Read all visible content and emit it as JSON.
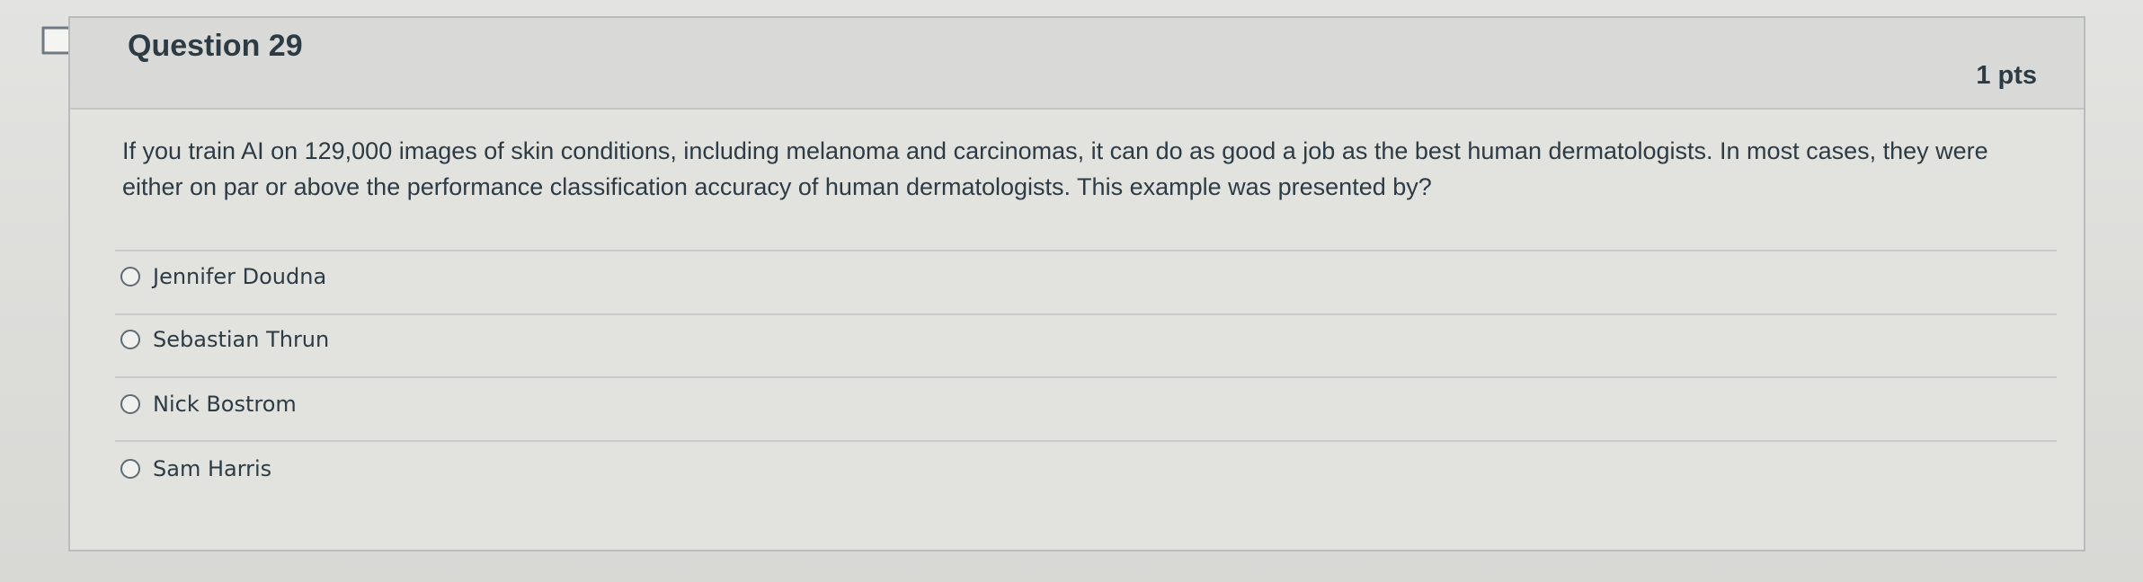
{
  "question": {
    "title": "Question 29",
    "points": "1 pts",
    "text": "If you train AI on 129,000 images of skin conditions, including melanoma and carcinomas, it can do as good a job as the best human dermatologists. In most cases, they were either on par or above the performance classification accuracy of human dermatologists. This example was presented by?"
  },
  "answers": [
    {
      "label": "Jennifer Doudna"
    },
    {
      "label": "Sebastian Thrun"
    },
    {
      "label": "Nick Bostrom"
    },
    {
      "label": "Sam Harris"
    }
  ],
  "icons": {
    "flag": "flag-question-icon",
    "radio": "radio-button-icon"
  }
}
